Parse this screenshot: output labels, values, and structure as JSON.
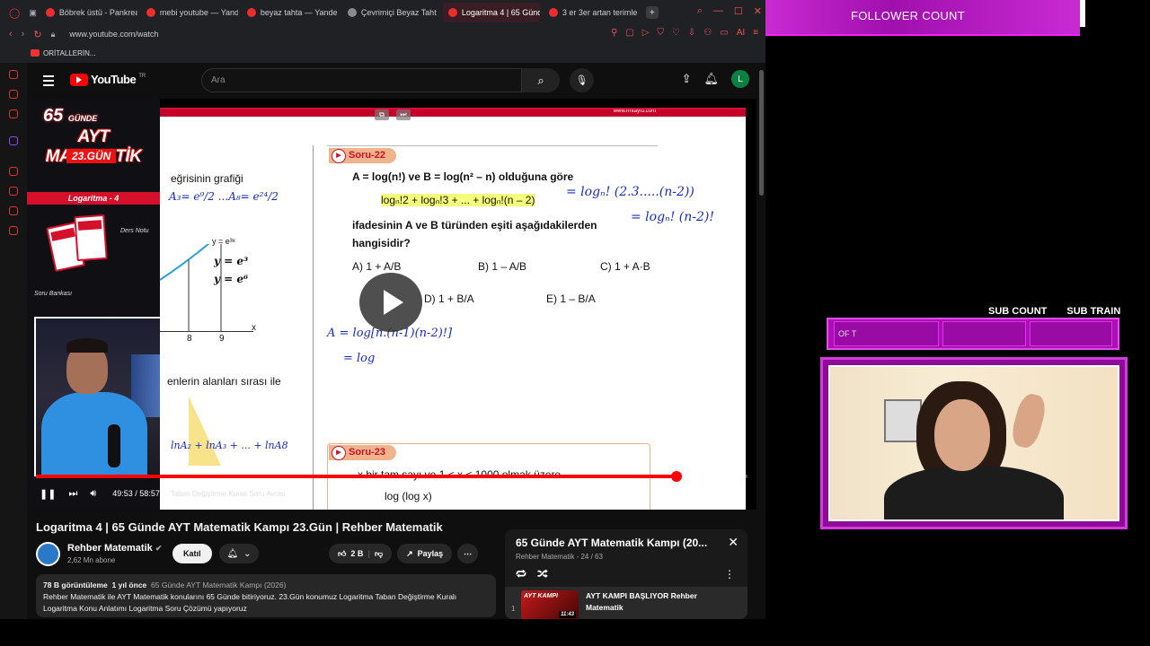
{
  "browser": {
    "tabs": [
      {
        "label": "Böbrek üstü - Pankrea",
        "fav": "y",
        "active": false
      },
      {
        "label": "mebi youtube — Yande",
        "fav": "y",
        "active": false
      },
      {
        "label": "beyaz tahta — Yande",
        "fav": "y",
        "active": false
      },
      {
        "label": "Çevrimiçi Beyaz Taht",
        "fav": "w",
        "active": false
      },
      {
        "label": "Logaritma 4 | 65 Günd",
        "fav": "y",
        "active": true
      },
      {
        "label": "3 er 3er artan terimle",
        "fav": "y",
        "active": false
      }
    ],
    "url": "www.youtube.com/watch",
    "bookmark": "ORİTALLERİN..."
  },
  "youtube": {
    "logo": "YouTube",
    "region": "TR",
    "search_placeholder": "Ara",
    "avatar_letter": "L"
  },
  "video_overlay": {
    "badge_number": "65",
    "badge_word": "GÜNDE",
    "title": "AYT MATEMATİK",
    "day": "23.GÜN",
    "topic": "Logaritma - 4",
    "ders_notu": "Ders Notu",
    "soru_bankasi": "Soru Bankası"
  },
  "whiteboard": {
    "site": "www.rmtayfu.com",
    "left_text_1": "eğrisinin grafiği",
    "left_eq": "A₃= e⁹/2  ...A₈= e²⁴/2",
    "curve_label": "y = e³ˣ",
    "hand_y1": "y = e³",
    "hand_y2": "y = e⁶",
    "tick_8": "8",
    "tick_9": "9",
    "axis_x": "x",
    "left_text_2": "enlerin alanları sırası ile",
    "left_bottom": "lnA₂ + lnA₃ + ... + lnA8",
    "soru22": "Soru-22",
    "q1": "A = log(n!) ve B = log(n² – n) olduğuna göre",
    "q_expr": "logₙ!2 + logₙ!3 + ... + logₙ!(n – 2)",
    "hand_expr": "= logₙ! (2.3.....(n-2))",
    "hand_expr2": "= logₙ! (n-2)!",
    "q2": "ifadesinin A ve B türünden eşiti aşağıdakilerden",
    "q3": "hangisidir?",
    "opt_a": "A) 1 + A/B",
    "opt_b": "B) 1 – A/B",
    "opt_c": "C) 1 + A·B",
    "opt_d": "D) 1 + B/A",
    "opt_e": "E) 1 – B/A",
    "hand_work1": "A = log[n.(n-1)(n-2)!]",
    "hand_work2": "= log",
    "soru23": "Soru-23",
    "q23": "x bir tam sayı ve 1 < x < 1000 olmak üzere",
    "q23b": "log (log x)"
  },
  "player": {
    "progress": 0.9,
    "time": "49:53 / 58:57",
    "chapter": "Taban Değiştirme Kuralı Soru Avcısı",
    "watermark": "rehbermatematik"
  },
  "video": {
    "title": "Logaritma 4 | 65 Günde AYT Matematik Kampı 23.Gün | Rehber Matematik",
    "channel": "Rehber Matematik",
    "subscribers": "2,62 Mn abone",
    "join": "Katıl",
    "likes": "2 B",
    "share": "Paylaş",
    "views": "78 B görüntüleme",
    "ago": "1 yıl önce",
    "playlist_tag": "65 Günde AYT Matematik Kampı (2026)",
    "description": "Rehber Matematik ile AYT Matematik konularını 65 Günde bitiriyoruz. 23.Gün konumuz Logaritma Taban Değiştirme Kuralı Logaritma Konu Anlatımı Logaritma Soru Çözümü yapıyoruz"
  },
  "playlist": {
    "title": "65 Günde AYT Matematik Kampı (20...",
    "sub": "Rehber Matematik - 24 / 63",
    "item_num": "1",
    "item_title": "AYT KAMPI BAŞLIYOR Rehber Matematik",
    "item_thumb": "AYT KAMPI",
    "item_time": "11:43"
  },
  "stream_overlay": {
    "follower_count": "FOLLOWER COUNT",
    "sub_count": "SUB COUNT",
    "sub_train": "SUB TRAIN",
    "sub_bar_text": "OF T"
  }
}
